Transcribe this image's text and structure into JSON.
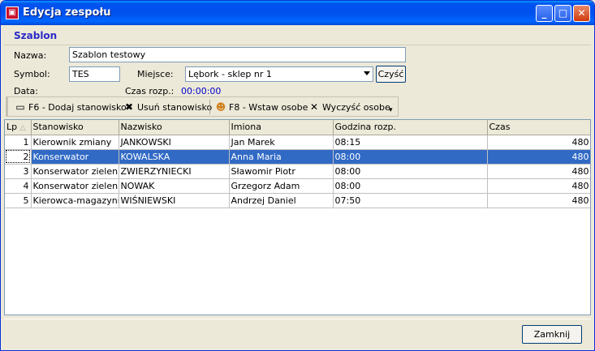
{
  "window": {
    "title": "Edycja zespołu",
    "icon": "app-icon"
  },
  "section": {
    "title": "Szablon"
  },
  "form": {
    "name_label": "Nazwa:",
    "name_value": "Szablon testowy",
    "symbol_label": "Symbol:",
    "symbol_value": "TES",
    "place_label": "Miejsce:",
    "place_value": "Lębork - sklep nr 1",
    "clear_label": "Czyść",
    "date_label": "Data:",
    "time_label": "Czas rozp.:",
    "time_value": "00:00:00"
  },
  "toolbar": {
    "add_label": "F6 - Dodaj stanowisko",
    "remove_label": "Usuń stanowisko",
    "insert_label": "F8 - Wstaw osobe",
    "clear_label": "Wyczyść osobe"
  },
  "table": {
    "headers": [
      "Lp",
      "Stanowisko",
      "Nazwisko",
      "Imiona",
      "Godzina rozp.",
      "Czas"
    ],
    "rows": [
      {
        "lp": "1",
        "stanowisko": "Kierownik zmiany",
        "nazwisko": "JANKOWSKI",
        "imiona": "Jan Marek",
        "godzina": "08:15",
        "czas": "480"
      },
      {
        "lp": "2",
        "stanowisko": "Konserwator",
        "nazwisko": "KOWALSKA",
        "imiona": "Anna Maria",
        "godzina": "08:00",
        "czas": "480"
      },
      {
        "lp": "3",
        "stanowisko": "Konserwator zieleni",
        "nazwisko": "ZWIERZYNIECKI",
        "imiona": "Sławomir Piotr",
        "godzina": "08:00",
        "czas": "480"
      },
      {
        "lp": "4",
        "stanowisko": "Konserwator zieleni",
        "nazwisko": "NOWAK",
        "imiona": "Grzegorz Adam",
        "godzina": "08:00",
        "czas": "480"
      },
      {
        "lp": "5",
        "stanowisko": "Kierowca-magazynier",
        "nazwisko": "WIŚNIEWSKI",
        "imiona": "Andrzej Daniel",
        "godzina": "07:50",
        "czas": "480"
      }
    ],
    "selected_row": 2
  },
  "footer": {
    "close_label": "Zamknij"
  },
  "colors": {
    "title_bar": "#0054e3",
    "selection": "#316ac5",
    "section_title": "#2a2ac8",
    "time_value": "#0000cc"
  }
}
